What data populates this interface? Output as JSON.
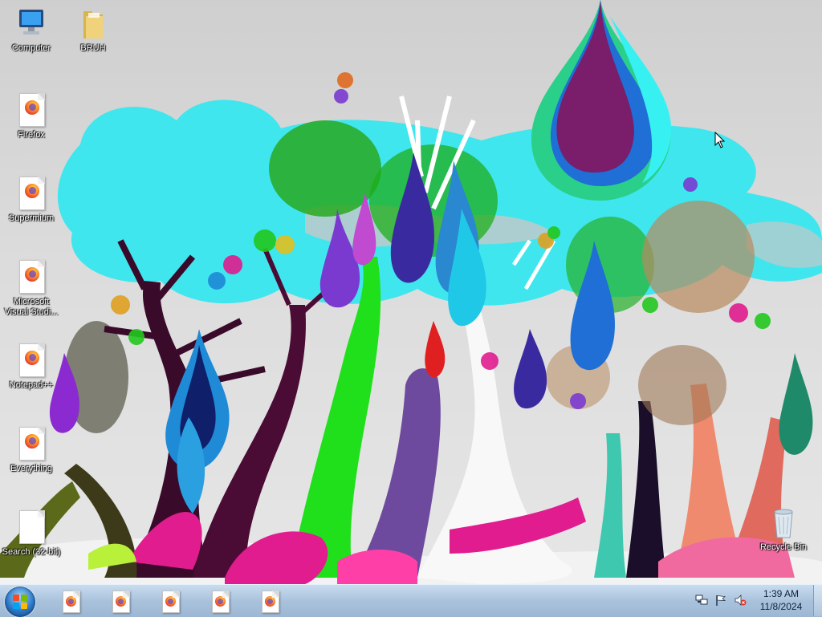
{
  "desktop": {
    "icons": [
      {
        "label": "Computer",
        "icon": "computer-icon"
      },
      {
        "label": "BRUH",
        "icon": "folder-icon"
      },
      {
        "label": "Firefox",
        "icon": "firefox-shortcut-icon"
      },
      {
        "label": "Supermium",
        "icon": "firefox-shortcut-icon"
      },
      {
        "label": "Microsoft Visual Studi...",
        "icon": "firefox-shortcut-icon"
      },
      {
        "label": "Notepad++",
        "icon": "firefox-shortcut-icon"
      },
      {
        "label": "Everything",
        "icon": "firefox-shortcut-icon"
      },
      {
        "label": "Search (32-bit)",
        "icon": "blank-document-icon"
      },
      {
        "label": "Recycle Bin",
        "icon": "recycle-bin-icon"
      }
    ]
  },
  "taskbar": {
    "start_icon": "windows-logo-icon",
    "pinned": [
      {
        "icon": "firefox-icon"
      },
      {
        "icon": "firefox-icon"
      },
      {
        "icon": "firefox-icon"
      },
      {
        "icon": "firefox-icon"
      },
      {
        "icon": "firefox-icon"
      }
    ],
    "tray": {
      "icons": [
        "network-icon",
        "action-center-flag-icon",
        "volume-muted-icon"
      ],
      "time": "1:39 AM",
      "date": "11/8/2024"
    }
  },
  "colors": {
    "taskbar": "#a9c2dc",
    "cloud": "#3fe6ee",
    "accent_magenta": "#e01c8e",
    "accent_green": "#22c81e",
    "accent_purple": "#5a1a6e"
  }
}
